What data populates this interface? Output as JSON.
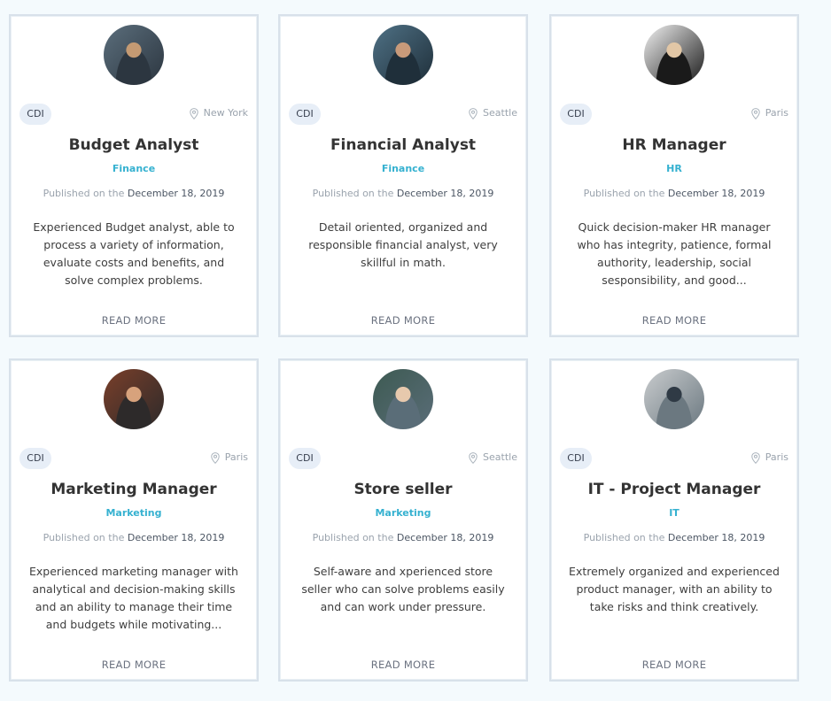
{
  "published_prefix": "Published on the",
  "cards": [
    {
      "contract": "CDI",
      "location": "New York",
      "title": "Budget Analyst",
      "department": "Finance",
      "date": "December 18, 2019",
      "description": "Experienced Budget analyst,  able to process a variety of information, evaluate costs and benefits, and solve complex problems.",
      "read_more": "READ MORE",
      "avatar_colors": [
        "#5b6e7c",
        "#c49a73",
        "#2c3640"
      ]
    },
    {
      "contract": "CDI",
      "location": "Seattle",
      "title": "Financial Analyst",
      "department": "Finance",
      "date": "December 18, 2019",
      "description": "Detail oriented, organized and responsible financial analyst, very skillful in math.",
      "read_more": "READ MORE",
      "avatar_colors": [
        "#4f7185",
        "#c89a7a",
        "#1f2f3a"
      ]
    },
    {
      "contract": "CDI",
      "location": "Paris",
      "title": "HR Manager",
      "department": "HR",
      "date": "December 18, 2019",
      "description": "Quick decision-maker HR manager who has integrity, patience, formal authority, leadership, social sesponsibility, and good...",
      "read_more": "READ MORE",
      "avatar_colors": [
        "#f2f2f2",
        "#e2c7a6",
        "#1a1a1a"
      ]
    },
    {
      "contract": "CDI",
      "location": "Paris",
      "title": "Marketing Manager",
      "department": "Marketing",
      "date": "December 18, 2019",
      "description": "Experienced marketing manager with  analytical and decision-making skills and  an ability to manage their time and budgets while motivating...",
      "read_more": "READ MORE",
      "avatar_colors": [
        "#7a3f2a",
        "#d7a27c",
        "#2d2a2a"
      ]
    },
    {
      "contract": "CDI",
      "location": "Seattle",
      "title": "Store seller",
      "department": "Marketing",
      "date": "December 18, 2019",
      "description": "Self-aware and xperienced store seller who can solve problems easily and can work under pressure.",
      "read_more": "READ MORE",
      "avatar_colors": [
        "#3d5a52",
        "#e7c9ad",
        "#5a6d78"
      ]
    },
    {
      "contract": "CDI",
      "location": "Paris",
      "title": "IT - Project Manager",
      "department": "IT",
      "date": "December 18, 2019",
      "description": "Extremely organized and experienced product manager, with an ability to take risks and think creatively.",
      "read_more": "READ MORE",
      "avatar_colors": [
        "#c9ccce",
        "#2f3a45",
        "#6b7880"
      ]
    }
  ]
}
